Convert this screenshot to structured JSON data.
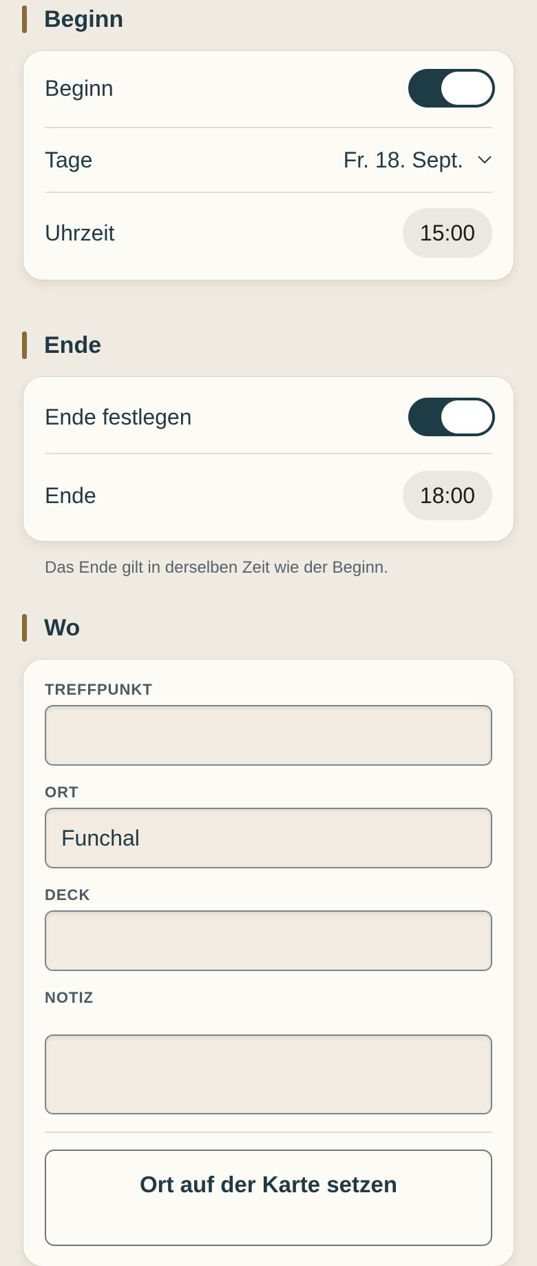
{
  "start_section": {
    "title": "Beginn",
    "toggle_label": "Beginn",
    "toggle_on": true,
    "day_label": "Tage",
    "day_value": "Fr. 18. Sept.",
    "time_label": "Uhrzeit",
    "time_value": "15:00"
  },
  "end_section": {
    "title": "Ende",
    "toggle_label": "Ende festlegen",
    "toggle_on": true,
    "time_label": "Ende",
    "time_value": "18:00",
    "hint": "Das Ende gilt in derselben Zeit wie der Beginn."
  },
  "where_section": {
    "title": "Wo",
    "meeting_point": {
      "label": "TREFFPUNKT",
      "value": ""
    },
    "place": {
      "label": "ORT",
      "value": "Funchal"
    },
    "deck": {
      "label": "DECK",
      "value": ""
    },
    "note": {
      "label": "NOTIZ",
      "value": ""
    },
    "map_button": "Ort auf der Karte setzen"
  },
  "colors": {
    "background": "#f0ebe2",
    "card": "#fdfbf6",
    "accent_bar": "#8a6a35",
    "toggle_on": "#1d3c45",
    "text": "#1f3a44"
  }
}
